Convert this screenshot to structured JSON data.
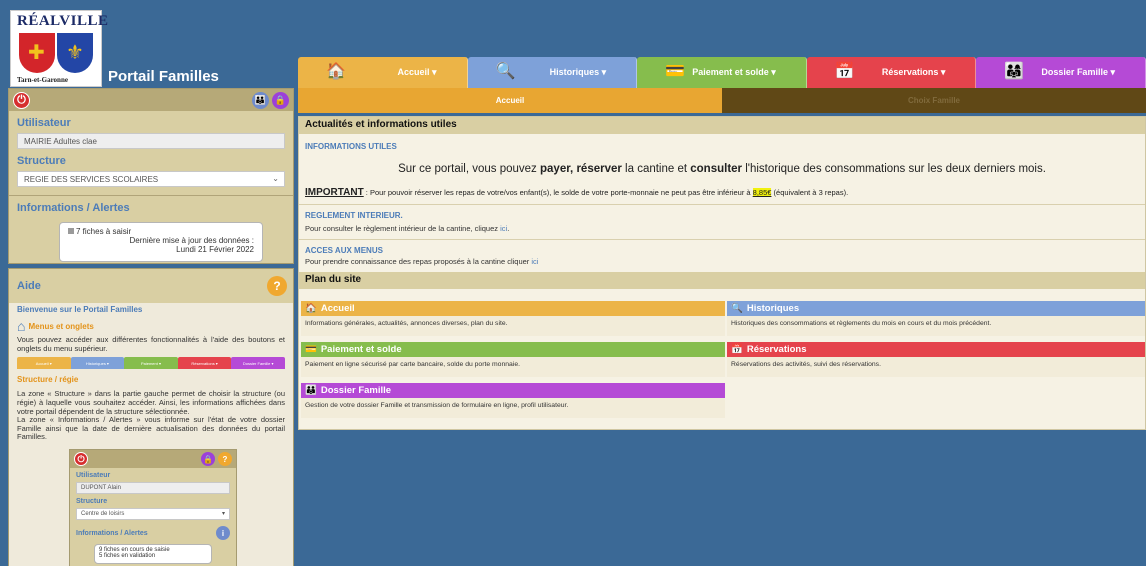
{
  "logo": {
    "brand": "RÉALVILLE",
    "tagline": "Tarn-et-Garonne"
  },
  "header": {
    "title": "Portail Familles"
  },
  "left_panel": {
    "user_label": "Utilisateur",
    "user_value": "MAIRIE Adultes clae",
    "structure_label": "Structure",
    "structure_value": "REGIE DES SERVICES SCOLAIRES",
    "alerts_label": "Informations / Alertes",
    "alerts_fiches": "7 fiches à saisir",
    "alerts_update_label": "Dernière mise à jour des données :",
    "alerts_update_date": "Lundi 21 Février 2022"
  },
  "aide": {
    "title": "Aide",
    "welcome": "Bienvenue sur le Portail Familles",
    "menus_title": "Menus et onglets",
    "menus_text": "Vous pouvez accéder aux différentes fonctionnalités à l'aide des boutons et onglets du menu supérieur.",
    "mini_tabs": [
      "Accueil ▾",
      "Historiques ▾",
      "Paiement ▾",
      "Réservations ▾",
      "Dossier Famille ▾"
    ],
    "structure_title": "Structure / régie",
    "structure_text1": "La zone « Structure » dans la partie gauche permet de choisir la structure (ou régie) à laquelle vous souhaitez accéder. Ainsi, les informations affichées dans votre portail dépendent de la structure sélectionnée.",
    "structure_text2": "La zone « Informations / Alertes » vous informe sur l'état de votre dossier Famille ainsi que la date de dernière actualisation des données du portail Familles.",
    "example": {
      "user_label": "Utilisateur",
      "user_value": "DUPONT Alain",
      "structure_label": "Structure",
      "structure_value": "Centre de loisirs",
      "alerts_label": "Informations / Alertes",
      "alerts_item1": "9 fiches en cours de saisie",
      "alerts_item2": "5 fiches en validation"
    }
  },
  "nav": {
    "tabs": [
      {
        "label": "Accueil ▾"
      },
      {
        "label": "Historiques ▾"
      },
      {
        "label": "Paiement et solde ▾"
      },
      {
        "label": "Réservations ▾"
      },
      {
        "label": "Dossier Famille ▾"
      }
    ],
    "subtabs": [
      "Accueil",
      "Choix Famille"
    ]
  },
  "content": {
    "news_title": "Actualités et informations utiles",
    "info_title": "INFORMATIONS UTILES",
    "info_line": {
      "p1": "Sur ce portail, vous pouvez ",
      "b1": "payer, réserver",
      "p2": " la cantine et ",
      "b2": "consulter",
      "p3": " l'historique des consommations sur les deux derniers mois."
    },
    "important": {
      "label": "IMPORTANT",
      "p1": " : Pour pouvoir réserver les repas de votre/vos enfant(s), le solde de votre porte-monnaie ne peut pas être inférieur à ",
      "amount": "8,85€",
      "p2": " (équivalent à 3 repas)."
    },
    "reglement_title": "REGLEMENT INTERIEUR.",
    "reglement_text": "Pour consulter le règlement intérieur de la cantine, cliquez ",
    "reglement_link": "ici",
    "reglement_end": ".",
    "menus_title": "ACCES AUX MENUS",
    "menus_text": "Pour prendre connaissance des repas proposés à la cantine cliquer ",
    "menus_link": "ici",
    "plan_title": "Plan du site",
    "plan": [
      {
        "title": "Accueil",
        "desc": "Informations générales, actualités, annonces diverses, plan du site.",
        "color": "#ecb447"
      },
      {
        "title": "Historiques",
        "desc": "Historiques des consommations et règlements du mois en cours et du mois précédent.",
        "color": "#7ea1d9"
      },
      {
        "title": "Paiement et solde",
        "desc": "Paiement en ligne sécurisé par carte bancaire, solde du porte monnaie.",
        "color": "#86bd4d"
      },
      {
        "title": "Réservations",
        "desc": "Réservations des activités, suivi des réservations.",
        "color": "#e5434c"
      },
      {
        "title": "Dossier Famille",
        "desc": "Gestion de votre dossier Famille et transmission de formulaire en ligne, profil utilisateur.",
        "color": "#b54ad6"
      }
    ]
  }
}
